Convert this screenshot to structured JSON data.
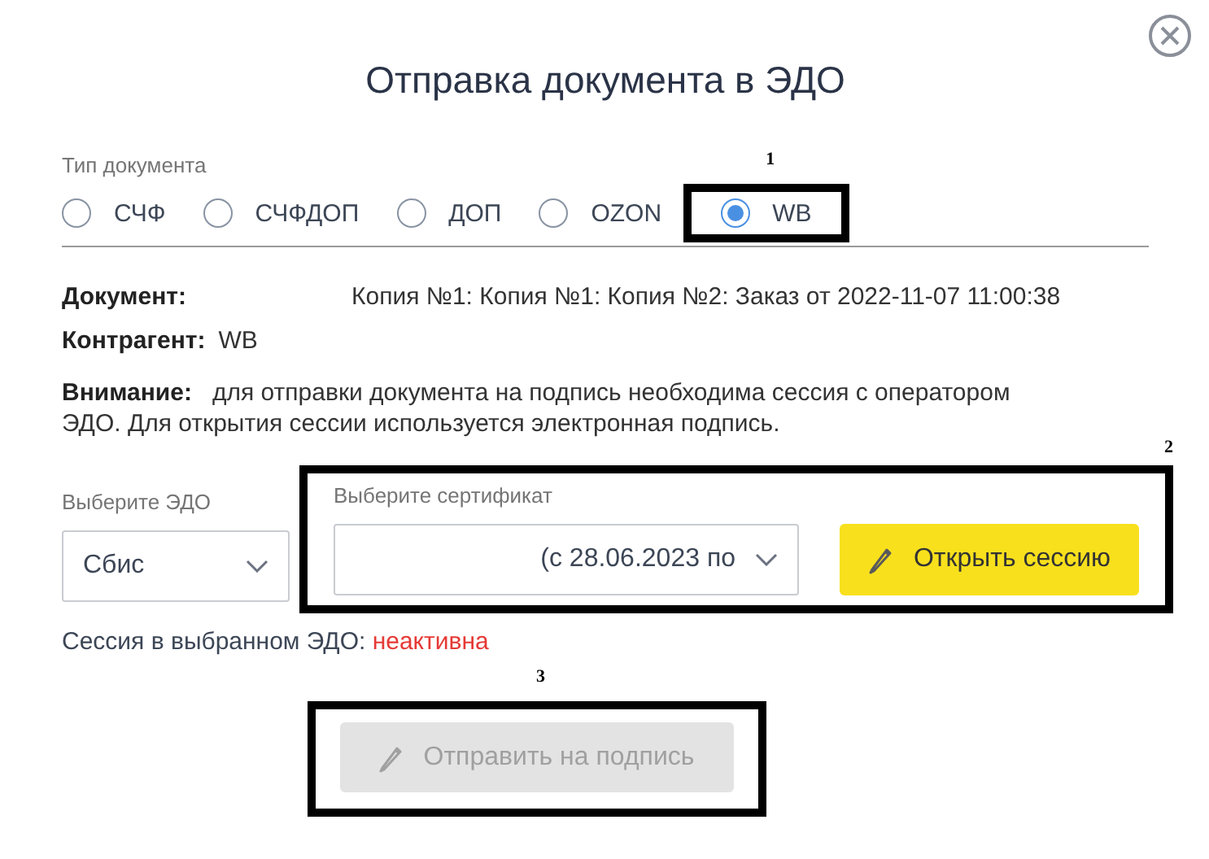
{
  "dialog": {
    "title": "Отправка документа в ЭДО"
  },
  "doc_type": {
    "label": "Тип документа",
    "options": [
      {
        "label": "СЧФ",
        "selected": false
      },
      {
        "label": "СЧФДОП",
        "selected": false
      },
      {
        "label": "ДОП",
        "selected": false
      },
      {
        "label": "OZON",
        "selected": false
      },
      {
        "label": "WB",
        "selected": true,
        "callout": "1"
      }
    ]
  },
  "document": {
    "label": "Документ:",
    "value": "Копия №1: Копия №1: Копия №2: Заказ от 2022-11-07 11:00:38"
  },
  "counterparty": {
    "label": "Контрагент:",
    "value": "WB"
  },
  "notice": {
    "label": "Внимание:",
    "text": "для отправки документа на подпись необходима сессия с оператором ЭДО. Для открытия сессии используется электронная подпись."
  },
  "edo_select": {
    "label": "Выберите ЭДО",
    "value": "Сбис"
  },
  "certificate": {
    "callout": "2",
    "label": "Выберите сертификат",
    "value": "(с 28.06.2023 по",
    "button": "Открыть сессию"
  },
  "session": {
    "label": "Сессия в выбранном ЭДО:",
    "status": "неактивна",
    "active": false
  },
  "send_button": {
    "label": "Отправить на подпись",
    "disabled": true,
    "callout": "3"
  }
}
